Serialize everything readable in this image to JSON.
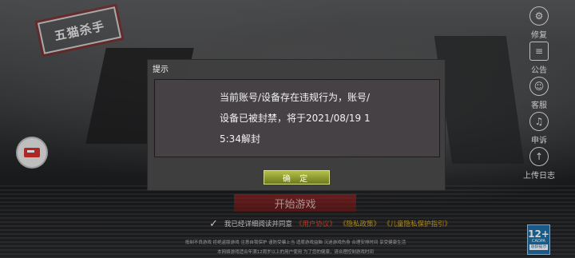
{
  "background": {
    "logo_text": "五猫杀手",
    "start_button_label": "开始游戏",
    "agreement": {
      "checked": true,
      "text": "我已经详细阅读并同意",
      "links": [
        "《用户协议》",
        "《隐私政策》",
        "《儿童隐私保护指引》"
      ]
    },
    "disclaimer_lines": [
      "抵制不良游戏 拒绝盗版游戏 注意自我保护 谨防受骗上当 适度游戏益脑 沉迷游戏伤身 合理安排时间 享受健康生活",
      "本网络游戏适合年满12周岁以上的用户使用   为了您的健康，请合理控制游戏时间"
    ],
    "age_badge": {
      "rating": "12+",
      "label": "CADPA",
      "caption": "适龄提示"
    }
  },
  "sidebar": {
    "items": [
      {
        "label": "修复",
        "icon": "repair-gear-icon"
      },
      {
        "label": "公告",
        "icon": "announcement-icon"
      },
      {
        "label": "客服",
        "icon": "customer-service-icon"
      },
      {
        "label": "申诉",
        "icon": "appeal-headset-icon"
      },
      {
        "label": "上传日志",
        "icon": "upload-log-icon"
      }
    ]
  },
  "dialog": {
    "title": "提示",
    "message": "当前账号/设备存在违规行为，账号/设备已被封禁，将于2021/08/19 15:34解封",
    "ok_label": "确 定"
  },
  "colors": {
    "accent_red": "#d44a38",
    "ok_button": "#9aa637",
    "dialog_bg": "#404040"
  }
}
